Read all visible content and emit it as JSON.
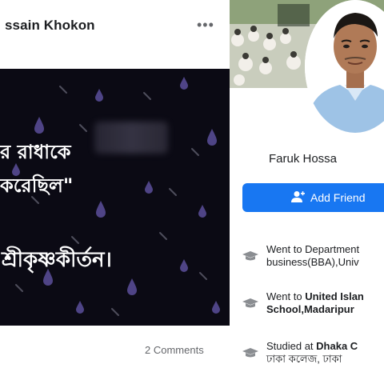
{
  "post": {
    "author": "ssain Khokon",
    "more_icon": "•••",
    "image_lines": [
      "রাধাকে",
      "করেছিল\"",
      "শ্রীকৃষ্ণকীর্তন।"
    ],
    "line1_prefix": "র",
    "comments": "2 Comments"
  },
  "profile": {
    "name": "Faruk Hossa",
    "add_friend_label": "Add Friend",
    "items": [
      {
        "pre": "Went to Department",
        "line2": "business(BBA),Univ"
      },
      {
        "pre": "Went to ",
        "bold": "United Islan",
        "line2_bold": "School,Madaripur"
      },
      {
        "pre": "Studied at ",
        "bold": "Dhaka C",
        "line2": "ঢাকা কলেজ, ঢাকা"
      }
    ]
  }
}
